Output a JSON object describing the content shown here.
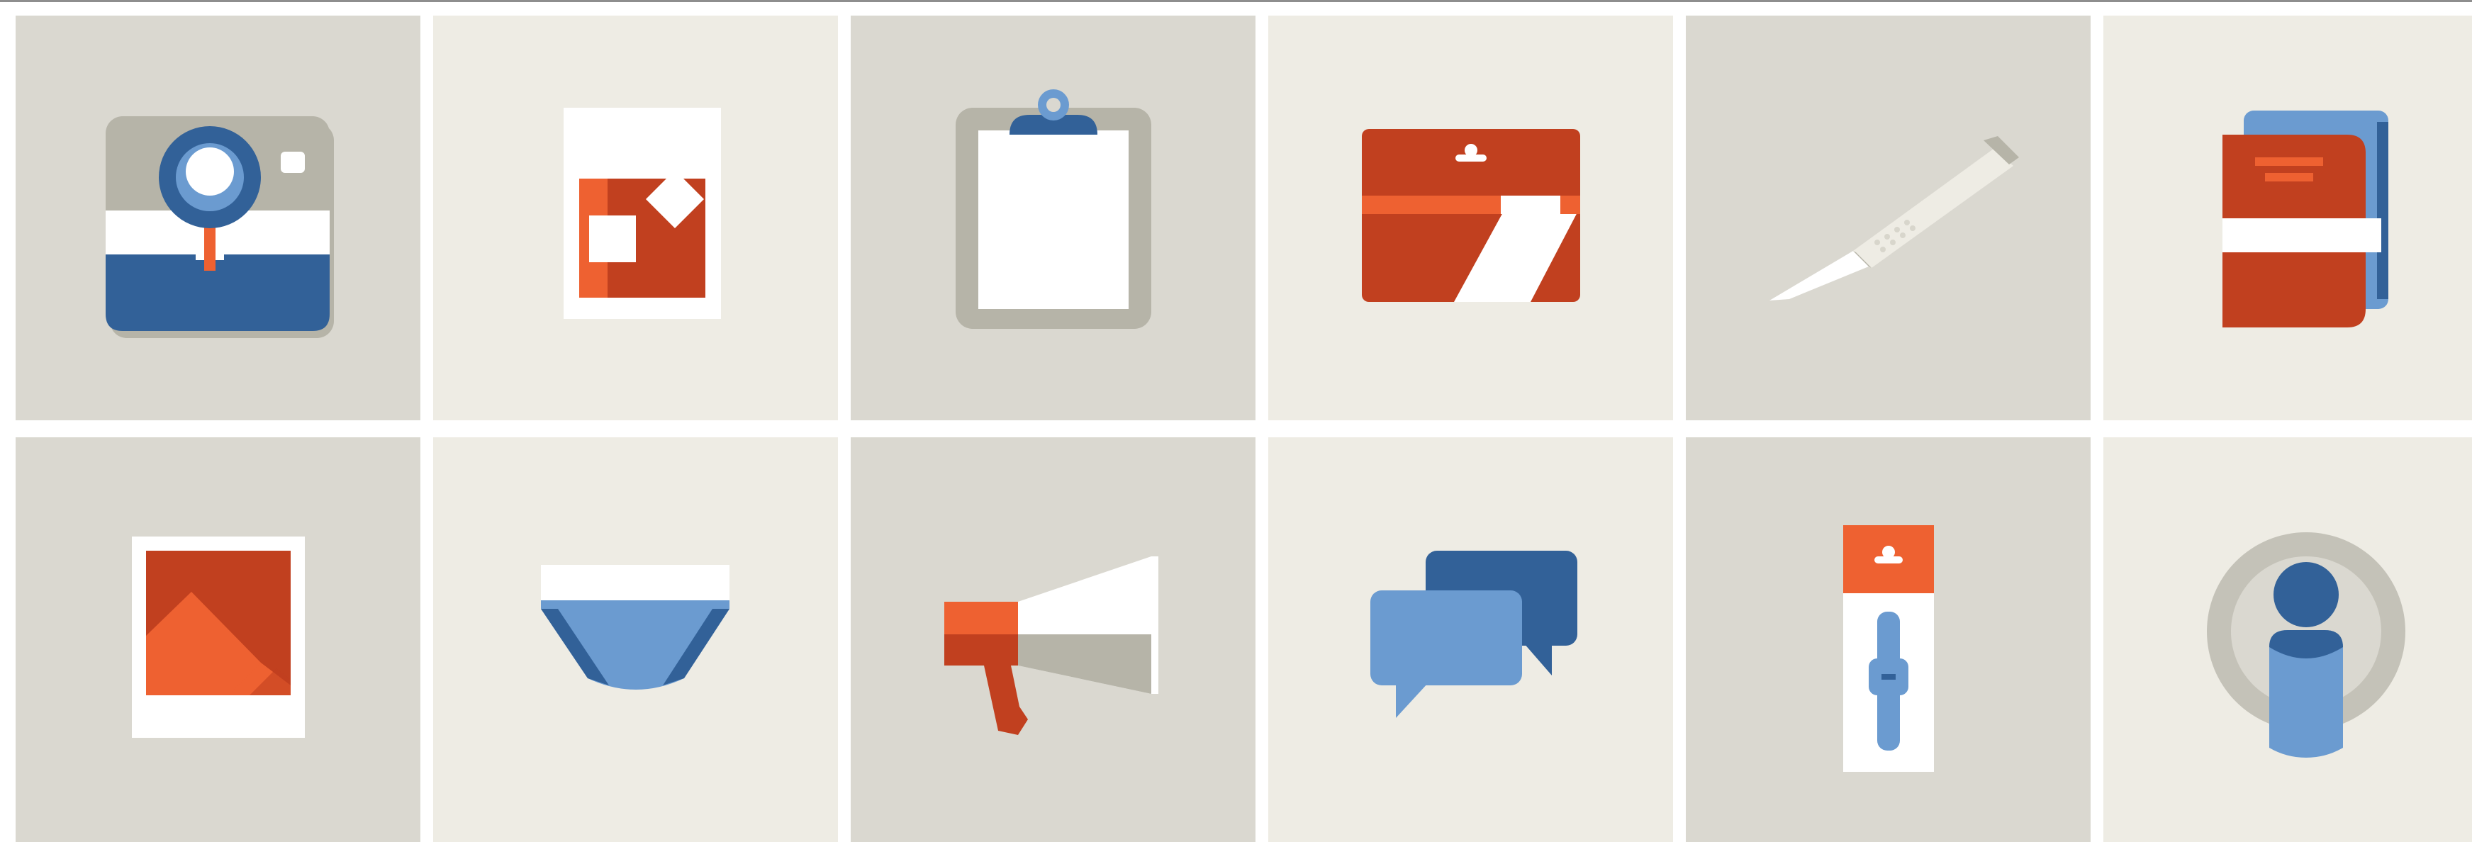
{
  "colors": {
    "tile_dark": "#dad8d0",
    "tile_light": "#eeece4",
    "red": "#c1401f",
    "orange": "#ee6131",
    "dark_blue": "#326198",
    "light_blue": "#6b9bd0",
    "gray": "#b6b4a8",
    "white": "#ffffff"
  },
  "tiles": [
    {
      "icon": "camera-icon",
      "shade": "dark"
    },
    {
      "icon": "gift-bag-icon",
      "shade": "light"
    },
    {
      "icon": "clipboard-icon",
      "shade": "dark"
    },
    {
      "icon": "pouch-icon",
      "shade": "light"
    },
    {
      "icon": "scalpel-icon",
      "shade": "dark"
    },
    {
      "icon": "notebook-icon",
      "shade": "light"
    },
    {
      "icon": "photo-icon",
      "shade": "dark"
    },
    {
      "icon": "underwear-icon",
      "shade": "light"
    },
    {
      "icon": "megaphone-icon",
      "shade": "dark"
    },
    {
      "icon": "chat-bubbles-icon",
      "shade": "light"
    },
    {
      "icon": "usb-drive-icon",
      "shade": "dark"
    },
    {
      "icon": "user-avatar-icon",
      "shade": "light"
    }
  ]
}
